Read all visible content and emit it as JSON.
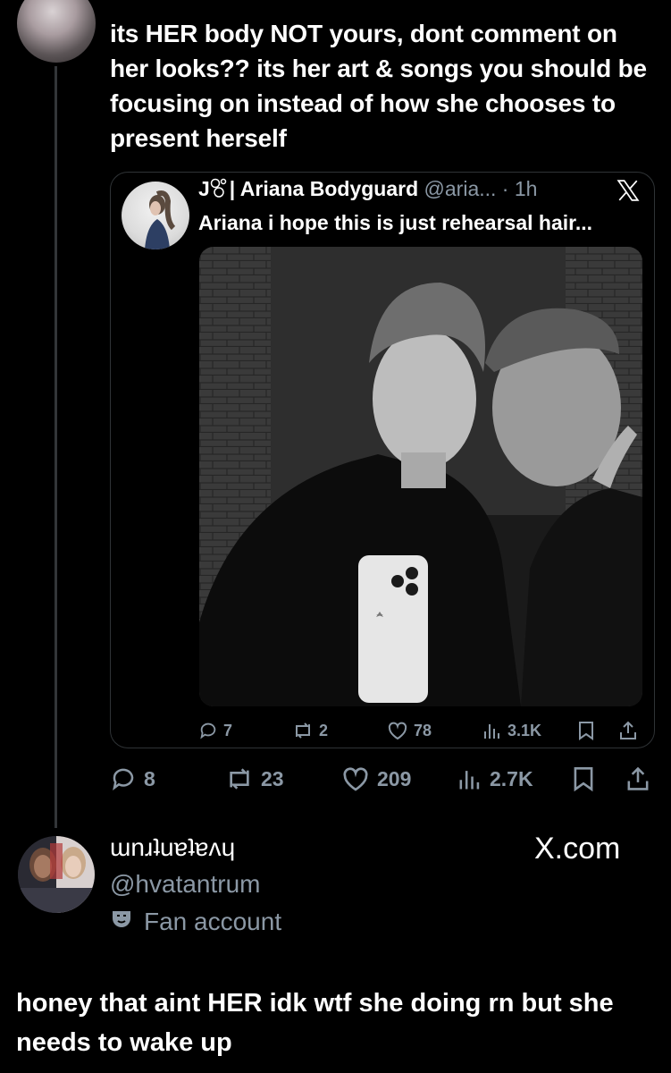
{
  "tweet": {
    "text": "its HER body NOT yours, dont comment on her looks?? its her art & songs you should be focusing on instead of how she chooses to present herself",
    "stats": {
      "replies": "8",
      "reposts": "23",
      "likes": "209",
      "views": "2.7K"
    }
  },
  "quote": {
    "name_prefix": "J",
    "name": "| Ariana Bodyguard",
    "handle": "@aria...",
    "time": "· 1h",
    "text": "Ariana i hope this is just rehearsal hair...",
    "stats": {
      "replies": "7",
      "reposts": "2",
      "likes": "78",
      "views": "3.1K"
    }
  },
  "reply_user": {
    "display_name": "ɯnɹʇuɐʇɐʌɥ",
    "handle": "@hvatantrum",
    "label": "Fan account"
  },
  "watermark": "X.com",
  "reply": {
    "text": "honey that aint HER idk wtf she doing rn but she needs to wake up"
  },
  "colors": {
    "background": "#000000",
    "text": "#e7e9ea",
    "muted": "#8b98a5",
    "border": "#2f3336"
  },
  "icons": [
    "reply-icon",
    "repost-icon",
    "like-icon",
    "views-icon",
    "bookmark-icon",
    "share-icon",
    "x-logo-icon",
    "mask-icon"
  ]
}
